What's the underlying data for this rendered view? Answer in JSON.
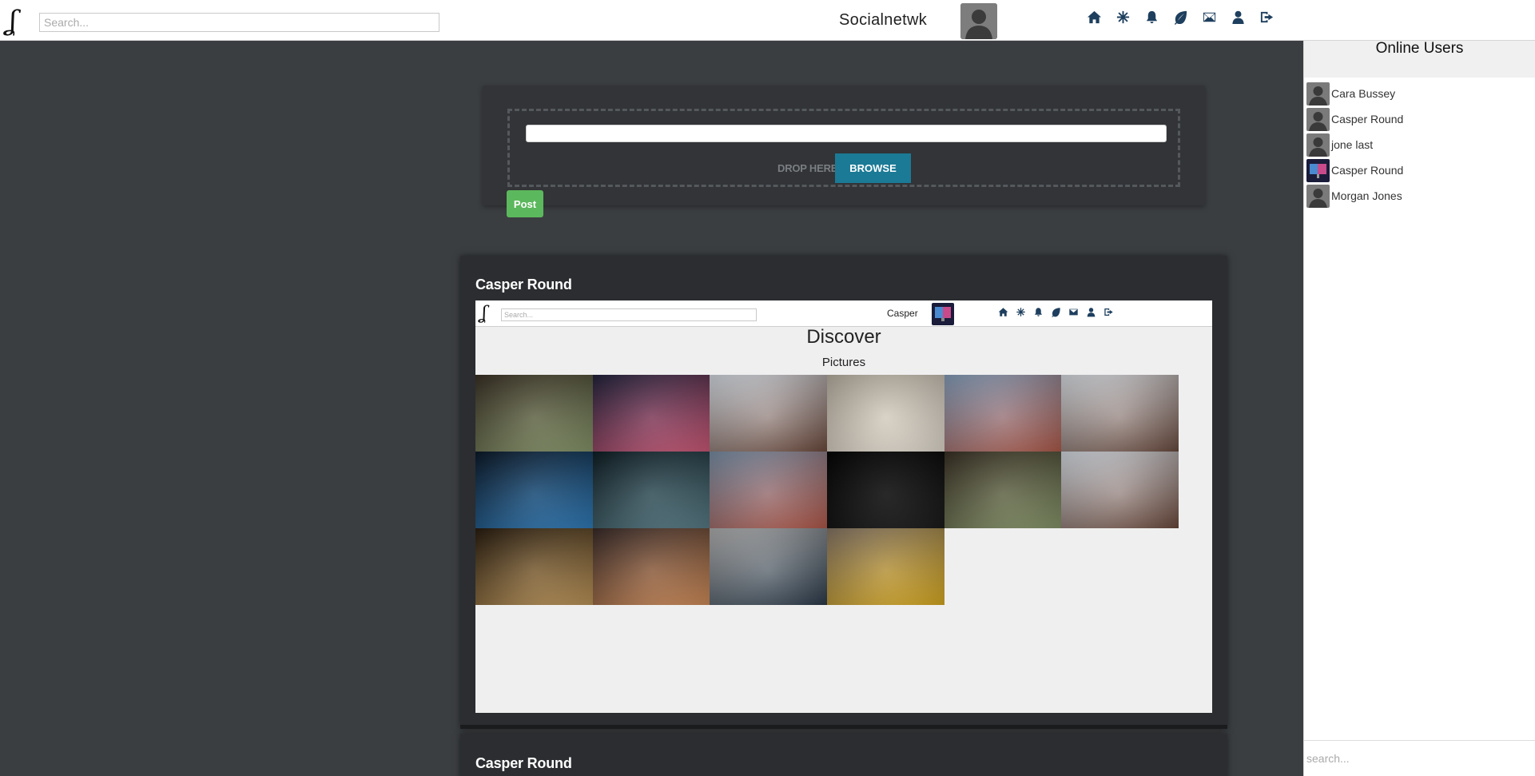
{
  "topbar": {
    "logo": "ʆ",
    "search_placeholder": "Search...",
    "brand": "Socialnetwk",
    "nav_icons": [
      "home-icon",
      "discover-icon",
      "bell-icon",
      "leaf-icon",
      "mail-icon",
      "user-icon",
      "logout-icon"
    ]
  },
  "composer": {
    "drop_label": "DROP HERE",
    "browse_label": "BROWSE",
    "post_label": "Post"
  },
  "posts": [
    {
      "author": "Casper Round",
      "preview": {
        "logo": "ʆ",
        "search_placeholder": "Search...",
        "user_name": "Casper",
        "title": "Discover",
        "subtitle": "Pictures",
        "tiles": [
          {
            "c1": "#3b3226",
            "c2": "#8a9a6c"
          },
          {
            "c1": "#23243e",
            "c2": "#d45a7a"
          },
          {
            "c1": "#dfe6ee",
            "c2": "#6d4a3c"
          },
          {
            "c1": "#bfb6a8",
            "c2": "#e9e2d6"
          },
          {
            "c1": "#8aa5c2",
            "c2": "#b35b4a"
          },
          {
            "c1": "#e3e8ee",
            "c2": "#6b4b3e"
          },
          {
            "c1": "#0c1a2a",
            "c2": "#2f7fc0"
          },
          {
            "c1": "#0f1f26",
            "c2": "#5a7f8a"
          },
          {
            "c1": "#7d95ad",
            "c2": "#b85a4a"
          },
          {
            "c1": "#050505",
            "c2": "#1a1a1a"
          },
          {
            "c1": "#3b3226",
            "c2": "#8a9a6c"
          },
          {
            "c1": "#dfe6ee",
            "c2": "#6d4a3c"
          },
          {
            "c1": "#2a1e10",
            "c2": "#c49a5a"
          },
          {
            "c1": "#3a2c2a",
            "c2": "#d8905a"
          },
          {
            "c1": "#b8b8b8",
            "c2": "#2a3a4a"
          },
          {
            "c1": "#8a7a6a",
            "c2": "#e0b020"
          }
        ]
      }
    },
    {
      "author": "Casper Round"
    }
  ],
  "sidebar": {
    "title": "Online Users",
    "users": [
      {
        "name": "Cara Bussey",
        "avatar": "default-avatar"
      },
      {
        "name": "Casper Round",
        "avatar": "default-avatar"
      },
      {
        "name": "jone last",
        "avatar": "default-avatar"
      },
      {
        "name": "Casper Round",
        "avatar": "colorful-avatar"
      },
      {
        "name": "Morgan Jones",
        "avatar": "default-avatar"
      }
    ],
    "search_placeholder": "search..."
  }
}
